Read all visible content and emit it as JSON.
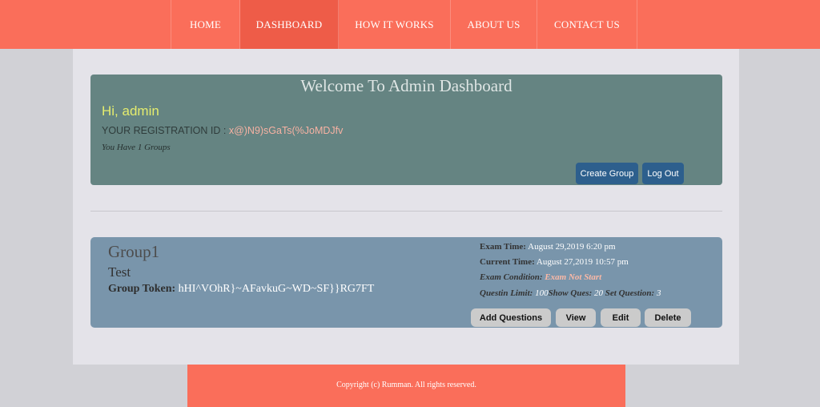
{
  "nav": {
    "items": [
      {
        "label": "HOME"
      },
      {
        "label": "DASHBOARD"
      },
      {
        "label": "HOW IT WORKS"
      },
      {
        "label": "ABOUT US"
      },
      {
        "label": "CONTACT US"
      }
    ],
    "active": "DASHBOARD"
  },
  "welcome": {
    "title": "Welcome To Admin Dashboard",
    "greeting": "Hi, admin",
    "reg_label": "YOUR REGISTRATION ID : ",
    "reg_value": "x@)N9)sGaTs(%JoMDJfv",
    "groups_count": "You Have 1 Groups",
    "create_group_label": "Create Group",
    "logout_label": "Log Out"
  },
  "group": {
    "name": "Group1",
    "description": "Test",
    "token_label": "Group Token:",
    "token_value": "hHI^VOhR}~AFavkuG~WD~SF}}RG7FT",
    "exam_time_label": "Exam Time:",
    "exam_time_value": "August 29,2019 6:20 pm",
    "current_time_label": "Current Time:",
    "current_time_value": "August 27,2019 10:57 pm",
    "exam_condition_label": "Exam Condition:",
    "exam_condition_value": "Exam Not Start",
    "question_limit_label": "Questin Limit:",
    "question_limit_value": "100",
    "show_ques_label": "Show Ques:",
    "show_ques_value": "20",
    "set_question_label": "Set Question:",
    "set_question_value": "3",
    "buttons": {
      "add_questions": "Add Questions",
      "view": "View",
      "edit": "Edit",
      "delete": "Delete"
    }
  },
  "footer": {
    "copyright": "Copyright (c) Rumman. All rights reserved."
  },
  "colors": {
    "header_bg": "#fa6e5a",
    "nav_active_bg": "#ee5c48",
    "welcome_panel_bg": "#658482",
    "group_card_bg": "#7995ab",
    "primary_button": "#2d5f8d",
    "greeting_text": "#e4ec6e",
    "registration_id_text": "#f7b2a3",
    "exam_condition_text": "#fcb9a6"
  }
}
